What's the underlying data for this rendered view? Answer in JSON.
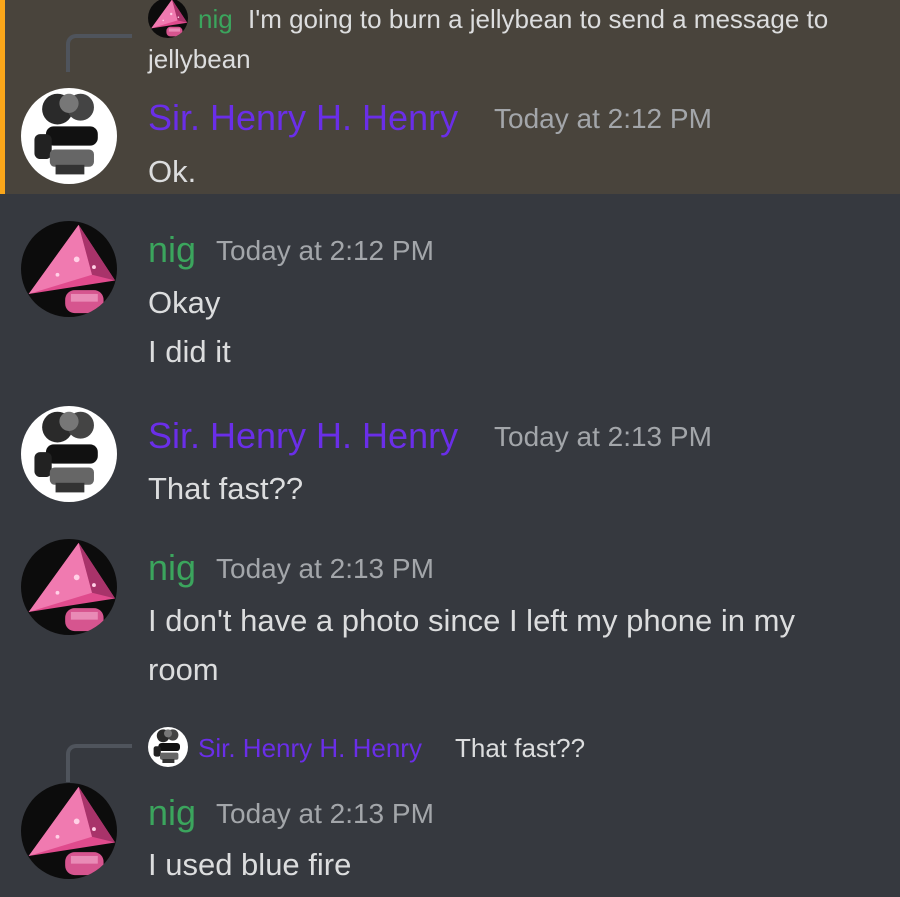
{
  "colors": {
    "background": "#36393f",
    "mention_highlight": "#49443c",
    "mention_bar": "#faa61a",
    "name_henry": "#6a2ee8",
    "name_nig": "#3ba55d"
  },
  "messages": [
    {
      "reply": {
        "author": "nig",
        "text": "I'm going to burn a jellybean to send a message to",
        "text_wrap": "jellybean"
      },
      "author": "Sir. Henry H. Henry",
      "timestamp": "Today at 2:12 PM",
      "lines": [
        "Ok."
      ]
    },
    {
      "author": "nig",
      "timestamp": "Today at 2:12 PM",
      "lines": [
        "Okay",
        "I did it"
      ]
    },
    {
      "author": "Sir. Henry H. Henry",
      "timestamp": "Today at 2:13 PM",
      "lines": [
        "That fast??"
      ]
    },
    {
      "author": "nig",
      "timestamp": "Today at 2:13 PM",
      "lines": [
        "I don't have a photo since I left my phone in my",
        "room"
      ]
    },
    {
      "reply": {
        "author": "Sir. Henry H. Henry",
        "text": "That fast??"
      },
      "author": "nig",
      "timestamp": "Today at 2:13 PM",
      "lines": [
        "I used blue fire"
      ]
    }
  ]
}
